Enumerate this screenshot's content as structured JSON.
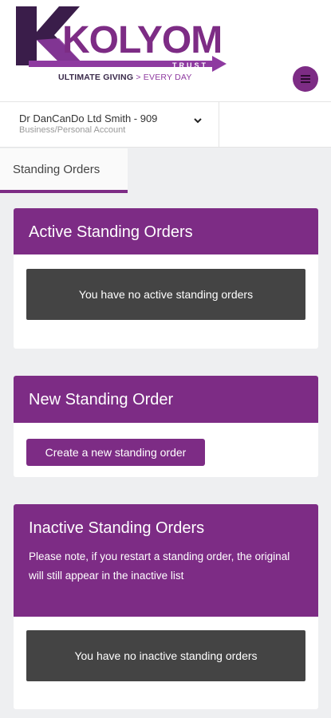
{
  "brand": {
    "logo_main": "KOLYOM",
    "logo_sub": "TRUST",
    "tagline_part1": "ULTIMATE GIVING",
    "tagline_sep": " > ",
    "tagline_part2": "EVERY DAY",
    "primary_color": "#7d2c85",
    "icon_menu": "hamburger-icon"
  },
  "account": {
    "name": "Dr DanCanDo Ltd Smith - 909",
    "type": "Business/Personal Account",
    "icon": "chevron-down-icon"
  },
  "tabs": [
    {
      "label": "Standing Orders",
      "active": true
    }
  ],
  "active_orders": {
    "title": "Active Standing Orders",
    "empty_message": "You have no active standing orders"
  },
  "new_order": {
    "title": "New Standing Order",
    "button_label": "Create a new standing order"
  },
  "inactive_orders": {
    "title": "Inactive Standing Orders",
    "note": "Please note, if you restart a standing order, the original will still appear in the inactive list",
    "empty_message": "You have no inactive standing orders"
  }
}
